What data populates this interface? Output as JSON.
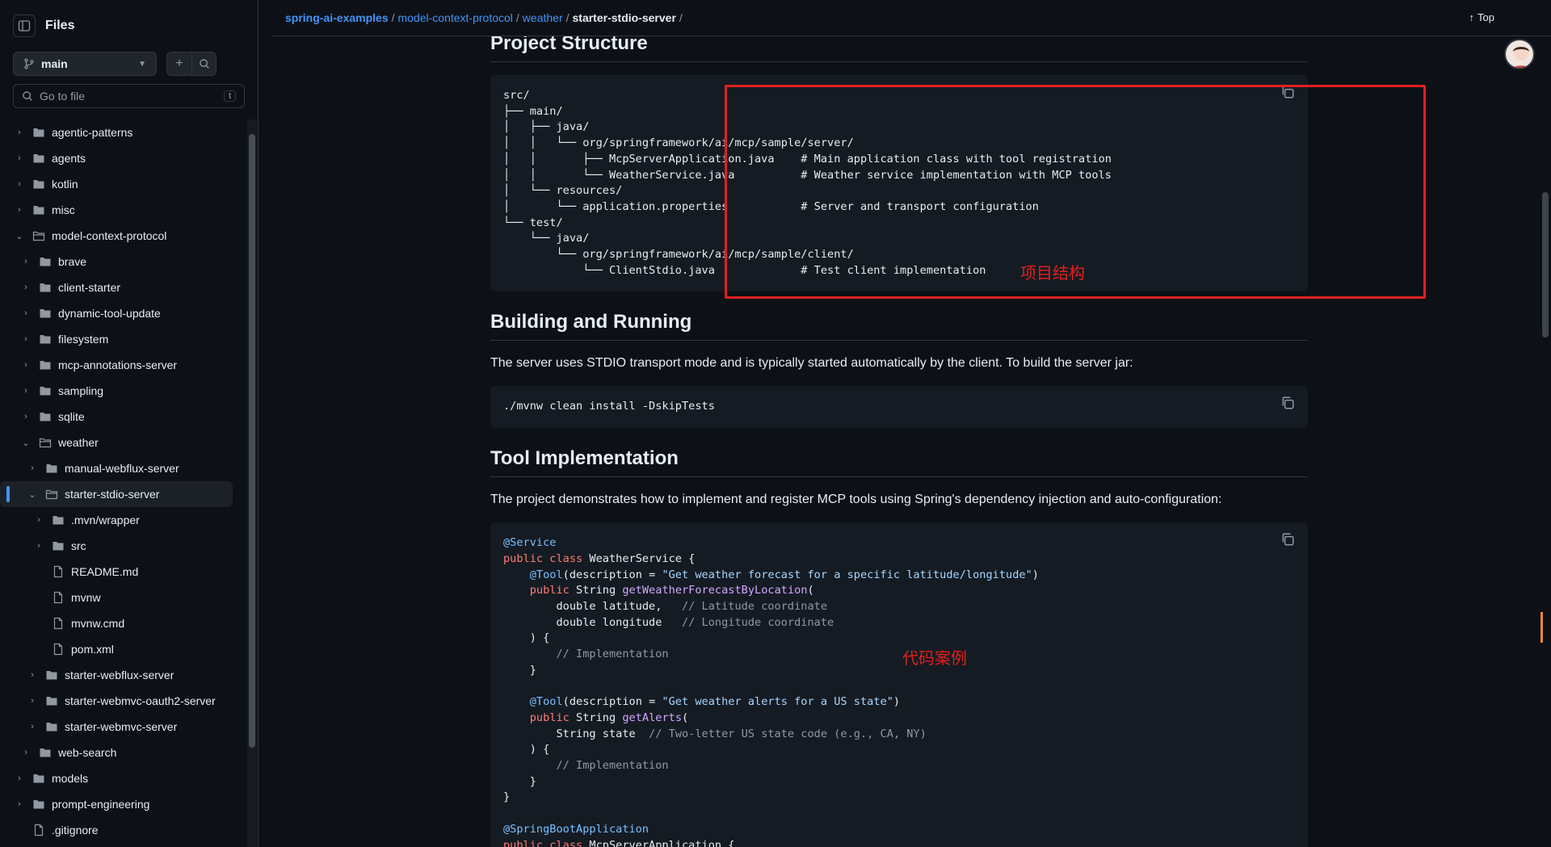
{
  "sidebar": {
    "title": "Files",
    "branch": "main",
    "goto_placeholder": "Go to file",
    "goto_shortcut": "t",
    "tree": [
      {
        "label": "agentic-patterns",
        "type": "folder",
        "depth": 0,
        "state": "collapsed"
      },
      {
        "label": "agents",
        "type": "folder",
        "depth": 0,
        "state": "collapsed"
      },
      {
        "label": "kotlin",
        "type": "folder",
        "depth": 0,
        "state": "collapsed"
      },
      {
        "label": "misc",
        "type": "folder",
        "depth": 0,
        "state": "collapsed"
      },
      {
        "label": "model-context-protocol",
        "type": "folder",
        "depth": 0,
        "state": "expanded"
      },
      {
        "label": "brave",
        "type": "folder",
        "depth": 1,
        "state": "collapsed"
      },
      {
        "label": "client-starter",
        "type": "folder",
        "depth": 1,
        "state": "collapsed"
      },
      {
        "label": "dynamic-tool-update",
        "type": "folder",
        "depth": 1,
        "state": "collapsed"
      },
      {
        "label": "filesystem",
        "type": "folder",
        "depth": 1,
        "state": "collapsed"
      },
      {
        "label": "mcp-annotations-server",
        "type": "folder",
        "depth": 1,
        "state": "collapsed"
      },
      {
        "label": "sampling",
        "type": "folder",
        "depth": 1,
        "state": "collapsed"
      },
      {
        "label": "sqlite",
        "type": "folder",
        "depth": 1,
        "state": "collapsed"
      },
      {
        "label": "weather",
        "type": "folder",
        "depth": 1,
        "state": "expanded"
      },
      {
        "label": "manual-webflux-server",
        "type": "folder",
        "depth": 2,
        "state": "collapsed"
      },
      {
        "label": "starter-stdio-server",
        "type": "folder",
        "depth": 2,
        "state": "expanded",
        "selected": true
      },
      {
        "label": ".mvn/wrapper",
        "type": "folder",
        "depth": 3,
        "state": "collapsed"
      },
      {
        "label": "src",
        "type": "folder",
        "depth": 3,
        "state": "collapsed"
      },
      {
        "label": "README.md",
        "type": "file",
        "depth": 3
      },
      {
        "label": "mvnw",
        "type": "file",
        "depth": 3
      },
      {
        "label": "mvnw.cmd",
        "type": "file",
        "depth": 3
      },
      {
        "label": "pom.xml",
        "type": "file",
        "depth": 3
      },
      {
        "label": "starter-webflux-server",
        "type": "folder",
        "depth": 2,
        "state": "collapsed"
      },
      {
        "label": "starter-webmvc-oauth2-server",
        "type": "folder",
        "depth": 2,
        "state": "collapsed"
      },
      {
        "label": "starter-webmvc-server",
        "type": "folder",
        "depth": 2,
        "state": "collapsed"
      },
      {
        "label": "web-search",
        "type": "folder",
        "depth": 1,
        "state": "collapsed"
      },
      {
        "label": "models",
        "type": "folder",
        "depth": 0,
        "state": "collapsed"
      },
      {
        "label": "prompt-engineering",
        "type": "folder",
        "depth": 0,
        "state": "collapsed"
      },
      {
        "label": ".gitignore",
        "type": "file",
        "depth": 0
      }
    ]
  },
  "breadcrumb": {
    "items": [
      "spring-ai-examples",
      "model-context-protocol",
      "weather"
    ],
    "current": "starter-stdio-server",
    "trailing": "/"
  },
  "top_link": "Top",
  "sections": {
    "project_structure": {
      "heading": "Project Structure",
      "tree_lines": [
        "src/",
        "├── main/",
        "│   ├── java/",
        "│   │   └── org/springframework/ai/mcp/sample/server/",
        "│   │       ├── McpServerApplication.java    # Main application class with tool registration",
        "│   │       └── WeatherService.java          # Weather service implementation with MCP tools",
        "│   └── resources/",
        "│       └── application.properties           # Server and transport configuration",
        "└── test/",
        "    └── java/",
        "        └── org/springframework/ai/mcp/sample/client/",
        "            └── ClientStdio.java             # Test client implementation"
      ],
      "annotation": "项目结构"
    },
    "building": {
      "heading": "Building and Running",
      "text": "The server uses STDIO transport mode and is typically started automatically by the client. To build the server jar:",
      "command": "./mvnw clean install -DskipTests"
    },
    "tool_impl": {
      "heading": "Tool Implementation",
      "text": "The project demonstrates how to implement and register MCP tools using Spring's dependency injection and auto-configuration:",
      "annotation": "代码案例",
      "code": {
        "ann_service": "@Service",
        "kw_public_class": "public class",
        "class_name": " WeatherService {",
        "ann_tool": "@Tool",
        "desc_prefix": "(description = ",
        "desc1": "\"Get weather forecast for a specific latitude/longitude\"",
        "close_paren": ")",
        "kw_public": "public",
        "type_string": " String ",
        "fn_forecast": "getWeatherForecastByLocation",
        "open_paren": "(",
        "param_lat": "        double latitude,   ",
        "cm_lat": "// Latitude coordinate",
        "param_lon": "        double longitude   ",
        "cm_lon": "// Longitude coordinate",
        "body_open": "    ) {",
        "cm_impl": "// Implementation",
        "brace_close": "    }",
        "desc2": "\"Get weather alerts for a US state\"",
        "fn_alerts": "getAlerts",
        "param_state": "        String state  ",
        "cm_state": "// Two-letter US state code (e.g., CA, NY)",
        "class_close": "}",
        "ann_boot": "@SpringBootApplication",
        "kw_last": "public class",
        "last_rest": " McpServerApplication {"
      }
    }
  },
  "colors": {
    "annotation_red": "#e0201e",
    "link_blue": "#4493f8"
  }
}
